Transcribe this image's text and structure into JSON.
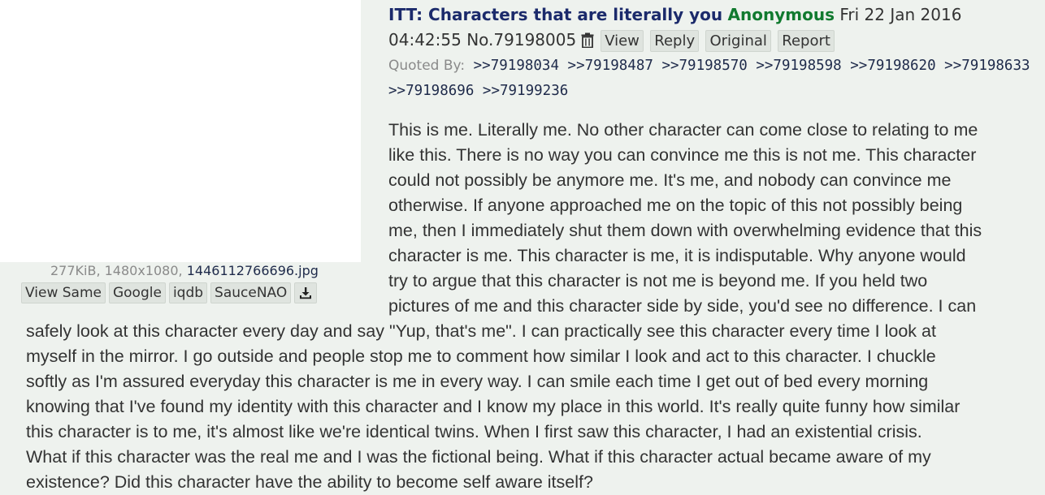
{
  "post": {
    "subject": "ITT: Characters that are literally you",
    "name": "Anonymous",
    "date": "Fri 22 Jan 2016 04:42:55",
    "number": "No.79198005",
    "actions": [
      "View",
      "Reply",
      "Original",
      "Report"
    ],
    "quoted_by_label": "Quoted By:",
    "quoted_by": [
      ">>79198034",
      ">>79198487",
      ">>79198570",
      ">>79198598",
      ">>79198620",
      ">>79198633",
      ">>79198696",
      ">>79199236"
    ]
  },
  "file": {
    "meta": "277KiB, 1480x1080,",
    "filename": "1446112766696.jpg",
    "tools": [
      "View Same",
      "Google",
      "iqdb",
      "SauceNAO"
    ]
  },
  "icons": {
    "delete": "trash-icon",
    "download": "download-icon"
  },
  "body": {
    "lines_beside_image": [
      "This is me. Literally me. No other character can come close to relating to me",
      "like this. There is no way you can convince me this is not me. This character",
      "could not possibly be anymore me. It's me, and nobody can convince me",
      "otherwise. If anyone approached me on the topic of this not possibly being",
      "me, then I immediately shut them down with overwhelming evidence that this",
      "character is me. This character is me, it is indisputable. Why anyone would",
      "try to argue that this character is not me is beyond me. If you held two",
      "pictures of me and this character side by side, you'd see no difference. I can"
    ],
    "lines_full_width": [
      "safely look at this character every day and say \"Yup, that's me\". I can practically see this character every time I look at",
      "myself in the mirror. I go outside and people stop me to comment how similar I look and act to this character. I chuckle",
      "softly as I'm assured everyday this character is me in every way. I can smile each time I get out of bed every morning",
      "knowing that I've found my identity with this character and I know my place in this world. It's really quite funny how similar",
      "this character is to me, it's almost like we're identical twins. When I first saw this character, I had an existential crisis.",
      "What if this character was the real me and I was the fictional being. What if this character actual became aware of my",
      "existence? Did this character have the ability to become self aware itself?"
    ]
  }
}
